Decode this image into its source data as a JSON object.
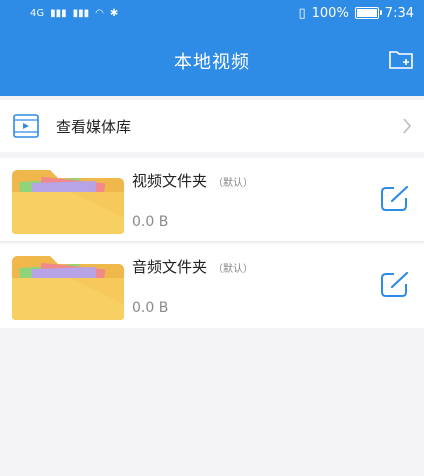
{
  "status_bar": {
    "network": "4G",
    "battery": "100%",
    "time": "7:34"
  },
  "header": {
    "title": "本地视频",
    "new_folder_icon": "folder-add-icon"
  },
  "media_library": {
    "label": "查看媒体库",
    "icon": "video-file-icon"
  },
  "folders": [
    {
      "name": "视频文件夹",
      "tag": "（默认）",
      "size": "0.0 B"
    },
    {
      "name": "音频文件夹",
      "tag": "（默认）",
      "size": "0.0 B"
    }
  ],
  "colors": {
    "primary": "#2e8be6",
    "folder": "#f7c95a",
    "edit": "#2e8be6"
  }
}
